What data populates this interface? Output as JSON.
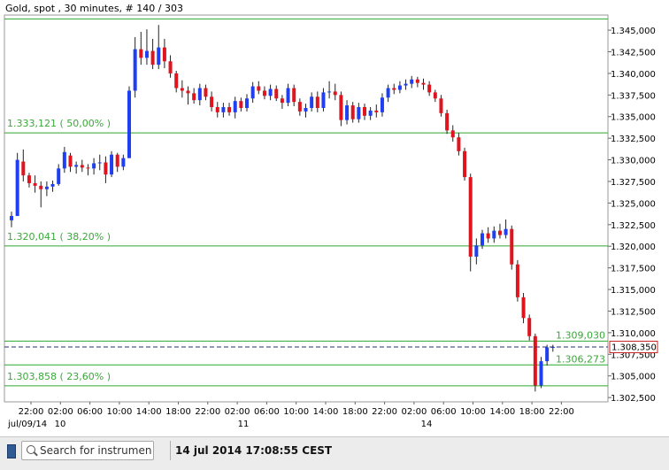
{
  "header": {
    "title": "Gold, spot , 30 minutes, # 140 / 303"
  },
  "bottom_bar": {
    "search_placeholder": "Search for instrument",
    "timestamp": "14 jul 2014 17:08:55 CEST"
  },
  "colors": {
    "up": "#1f3ff0",
    "down": "#e0141e",
    "fib": "#2ea82e",
    "fib_text": "#3aa83a",
    "price_line": "#1f2f8a",
    "price_box": "#cc2222"
  },
  "chart_data": {
    "type": "candlestick",
    "title": "Gold, spot , 30 minutes, # 140 / 303",
    "ylim": [
      1302000,
      1346750
    ],
    "y_ticks": [
      "1.345,000",
      "1.342,500",
      "1.340,000",
      "1.337,500",
      "1.335,000",
      "1.332,500",
      "1.330,000",
      "1.327,500",
      "1.325,000",
      "1.322,500",
      "1.320,000",
      "1.317,500",
      "1.315,000",
      "1.312,500",
      "1.310,000",
      "1.307,500",
      "1.305,000",
      "1.302,500"
    ],
    "y_tick_values": [
      1345000,
      1342500,
      1340000,
      1337500,
      1335000,
      1332500,
      1330000,
      1327500,
      1325000,
      1322500,
      1320000,
      1317500,
      1315000,
      1312500,
      1310000,
      1307500,
      1305000,
      1302500
    ],
    "x_ticks": [
      "22:00",
      "02:00",
      "06:00",
      "10:00",
      "14:00",
      "18:00",
      "22:00",
      "02:00",
      "06:00",
      "10:00",
      "14:00",
      "18:00",
      "22:00",
      "02:00",
      "06:00",
      "10:00",
      "14:00",
      "18:00",
      "22:00"
    ],
    "date_labels": [
      "jul/09/14",
      "10",
      "11",
      "14"
    ],
    "current_price": "1.308,350",
    "current_value": 1308350,
    "fib_levels": [
      {
        "value": 1346300,
        "label": ""
      },
      {
        "value": 1333121,
        "label": "1.333,121 ( 50,00% )"
      },
      {
        "value": 1320041,
        "label": "1.320,041 ( 38,20% )"
      },
      {
        "value": 1309030,
        "label": "1.309,030"
      },
      {
        "value": 1306273,
        "label": "1.306,273"
      },
      {
        "value": 1303858,
        "label": "1.303,858 ( 23,60% )"
      }
    ],
    "candles": [
      [
        1323000,
        1324000,
        1322200,
        1323500
      ],
      [
        1323500,
        1330800,
        1323500,
        1330000
      ],
      [
        1329800,
        1331200,
        1327500,
        1328200
      ],
      [
        1328200,
        1328500,
        1326800,
        1327300
      ],
      [
        1327300,
        1328200,
        1326200,
        1327000
      ],
      [
        1327000,
        1327500,
        1324500,
        1326600
      ],
      [
        1326600,
        1327500,
        1325800,
        1326900
      ],
      [
        1326900,
        1327600,
        1326300,
        1327200
      ],
      [
        1327200,
        1329500,
        1327000,
        1329000
      ],
      [
        1329000,
        1331500,
        1328500,
        1330900
      ],
      [
        1330500,
        1330800,
        1328600,
        1329200
      ],
      [
        1329200,
        1329800,
        1328400,
        1329400
      ],
      [
        1329400,
        1330000,
        1328600,
        1329100
      ],
      [
        1329100,
        1329500,
        1328200,
        1329000
      ],
      [
        1329000,
        1330200,
        1328300,
        1329600
      ],
      [
        1329600,
        1330600,
        1328800,
        1329700
      ],
      [
        1329700,
        1330400,
        1327300,
        1328300
      ],
      [
        1328300,
        1331000,
        1328000,
        1330600
      ],
      [
        1330600,
        1330800,
        1328600,
        1329200
      ],
      [
        1329200,
        1330600,
        1328800,
        1330200
      ],
      [
        1330200,
        1338500,
        1330200,
        1338000
      ],
      [
        1338000,
        1344200,
        1337200,
        1342800
      ],
      [
        1342800,
        1344800,
        1341000,
        1341800
      ],
      [
        1341800,
        1345100,
        1341000,
        1342600
      ],
      [
        1342600,
        1344000,
        1340500,
        1341000
      ],
      [
        1341000,
        1345600,
        1340500,
        1343000
      ],
      [
        1343000,
        1344000,
        1340600,
        1341400
      ],
      [
        1341400,
        1342100,
        1339500,
        1340000
      ],
      [
        1340000,
        1340300,
        1337800,
        1338300
      ],
      [
        1338300,
        1339200,
        1337200,
        1338000
      ],
      [
        1338000,
        1338500,
        1336400,
        1337700
      ],
      [
        1337700,
        1338300,
        1336500,
        1336900
      ],
      [
        1336900,
        1338800,
        1336300,
        1338300
      ],
      [
        1338300,
        1338700,
        1336900,
        1337300
      ],
      [
        1337300,
        1337900,
        1335600,
        1336100
      ],
      [
        1336100,
        1336700,
        1334900,
        1335500
      ],
      [
        1335500,
        1336600,
        1334900,
        1336100
      ],
      [
        1336100,
        1336600,
        1335100,
        1335500
      ],
      [
        1335500,
        1337300,
        1334800,
        1336800
      ],
      [
        1336800,
        1337200,
        1335600,
        1336000
      ],
      [
        1336000,
        1337600,
        1335600,
        1337100
      ],
      [
        1337100,
        1339000,
        1336600,
        1338500
      ],
      [
        1338500,
        1339100,
        1337600,
        1338000
      ],
      [
        1338000,
        1338500,
        1337000,
        1337400
      ],
      [
        1337400,
        1338700,
        1336900,
        1338200
      ],
      [
        1338200,
        1338600,
        1336800,
        1337100
      ],
      [
        1337100,
        1337500,
        1335900,
        1336600
      ],
      [
        1336600,
        1338800,
        1336200,
        1338300
      ],
      [
        1338300,
        1338700,
        1336200,
        1336700
      ],
      [
        1336700,
        1337100,
        1335100,
        1335600
      ],
      [
        1335600,
        1336500,
        1334900,
        1336000
      ],
      [
        1336000,
        1337800,
        1335600,
        1337300
      ],
      [
        1337300,
        1337900,
        1335500,
        1336000
      ],
      [
        1336000,
        1338300,
        1335600,
        1337800
      ],
      [
        1337800,
        1339100,
        1337100,
        1337900
      ],
      [
        1337900,
        1338800,
        1336900,
        1337500
      ],
      [
        1337500,
        1337900,
        1333900,
        1334600
      ],
      [
        1334600,
        1336900,
        1334100,
        1336300
      ],
      [
        1336300,
        1336700,
        1334300,
        1334700
      ],
      [
        1334700,
        1336600,
        1334300,
        1336100
      ],
      [
        1336100,
        1336500,
        1334600,
        1335100
      ],
      [
        1335100,
        1336100,
        1334600,
        1335700
      ],
      [
        1335700,
        1336400,
        1334900,
        1335500
      ],
      [
        1335500,
        1337700,
        1335000,
        1337200
      ],
      [
        1337200,
        1338700,
        1336700,
        1338300
      ],
      [
        1338300,
        1338800,
        1337600,
        1338100
      ],
      [
        1338100,
        1339100,
        1337700,
        1338600
      ],
      [
        1338600,
        1339300,
        1338100,
        1338800
      ],
      [
        1338800,
        1339700,
        1338300,
        1339300
      ],
      [
        1339300,
        1339600,
        1338400,
        1338900
      ],
      [
        1338900,
        1339400,
        1338100,
        1338700
      ],
      [
        1338700,
        1339100,
        1337400,
        1337800
      ],
      [
        1337800,
        1338100,
        1336700,
        1337100
      ],
      [
        1337100,
        1337500,
        1335000,
        1335400
      ],
      [
        1335400,
        1335800,
        1333000,
        1333400
      ],
      [
        1333400,
        1334000,
        1332100,
        1332600
      ],
      [
        1332600,
        1333100,
        1330500,
        1331000
      ],
      [
        1331000,
        1331400,
        1327600,
        1328000
      ],
      [
        1328000,
        1328400,
        1317100,
        1318800
      ],
      [
        1318800,
        1320900,
        1317900,
        1320100
      ],
      [
        1320100,
        1321900,
        1319700,
        1321500
      ],
      [
        1321500,
        1322200,
        1320400,
        1320900
      ],
      [
        1320900,
        1322300,
        1320400,
        1321800
      ],
      [
        1321800,
        1322600,
        1320900,
        1321300
      ],
      [
        1321300,
        1323100,
        1320900,
        1322000
      ],
      [
        1322000,
        1322400,
        1317300,
        1317900
      ],
      [
        1317900,
        1318400,
        1313600,
        1314100
      ],
      [
        1314100,
        1314600,
        1311100,
        1311700
      ],
      [
        1311700,
        1312100,
        1309100,
        1309600
      ],
      [
        1309600,
        1309900,
        1303200,
        1303900
      ],
      [
        1303900,
        1307200,
        1303600,
        1306700
      ],
      [
        1306700,
        1308600,
        1306200,
        1308300
      ],
      [
        1308300,
        1308600,
        1307800,
        1308350
      ]
    ]
  }
}
